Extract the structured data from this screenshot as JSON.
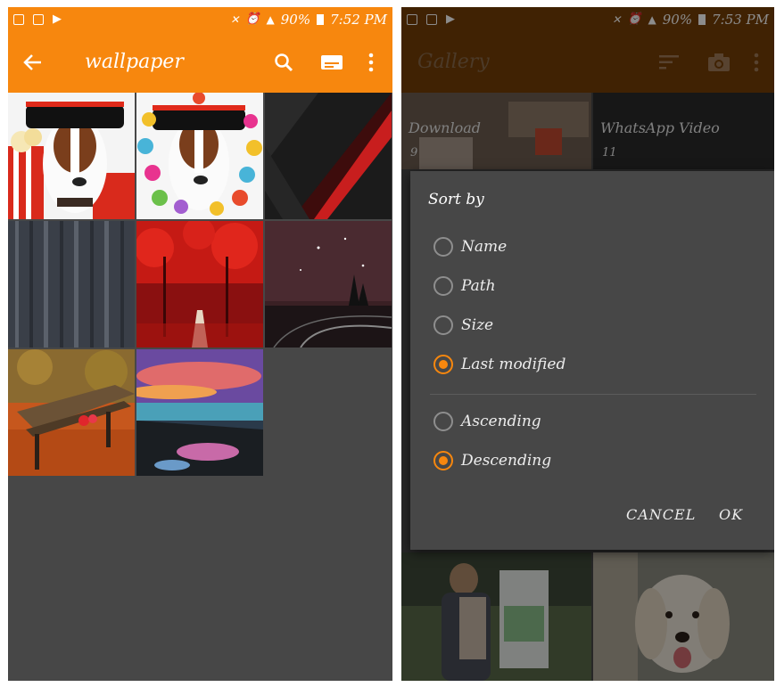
{
  "left": {
    "status": {
      "time": "7:52 PM",
      "battery": "90%"
    },
    "toolbar": {
      "title": "wallpaper"
    }
  },
  "right": {
    "status": {
      "time": "7:53 PM",
      "battery": "90%"
    },
    "toolbar": {
      "title": "Gallery"
    },
    "albums": [
      {
        "name": "Download",
        "count": "9"
      },
      {
        "name": "WhatsApp Video",
        "count": "11"
      }
    ],
    "dialog": {
      "title": "Sort by",
      "sort_options": [
        {
          "label": "Name",
          "selected": false
        },
        {
          "label": "Path",
          "selected": false
        },
        {
          "label": "Size",
          "selected": false
        },
        {
          "label": "Last modified",
          "selected": true
        }
      ],
      "order_options": [
        {
          "label": "Ascending",
          "selected": false
        },
        {
          "label": "Descending",
          "selected": true
        }
      ],
      "cancel_label": "CANCEL",
      "ok_label": "OK"
    }
  },
  "colors": {
    "accent": "#f7870e",
    "accent_dark": "#763f07",
    "dialog_bg": "#474747"
  }
}
